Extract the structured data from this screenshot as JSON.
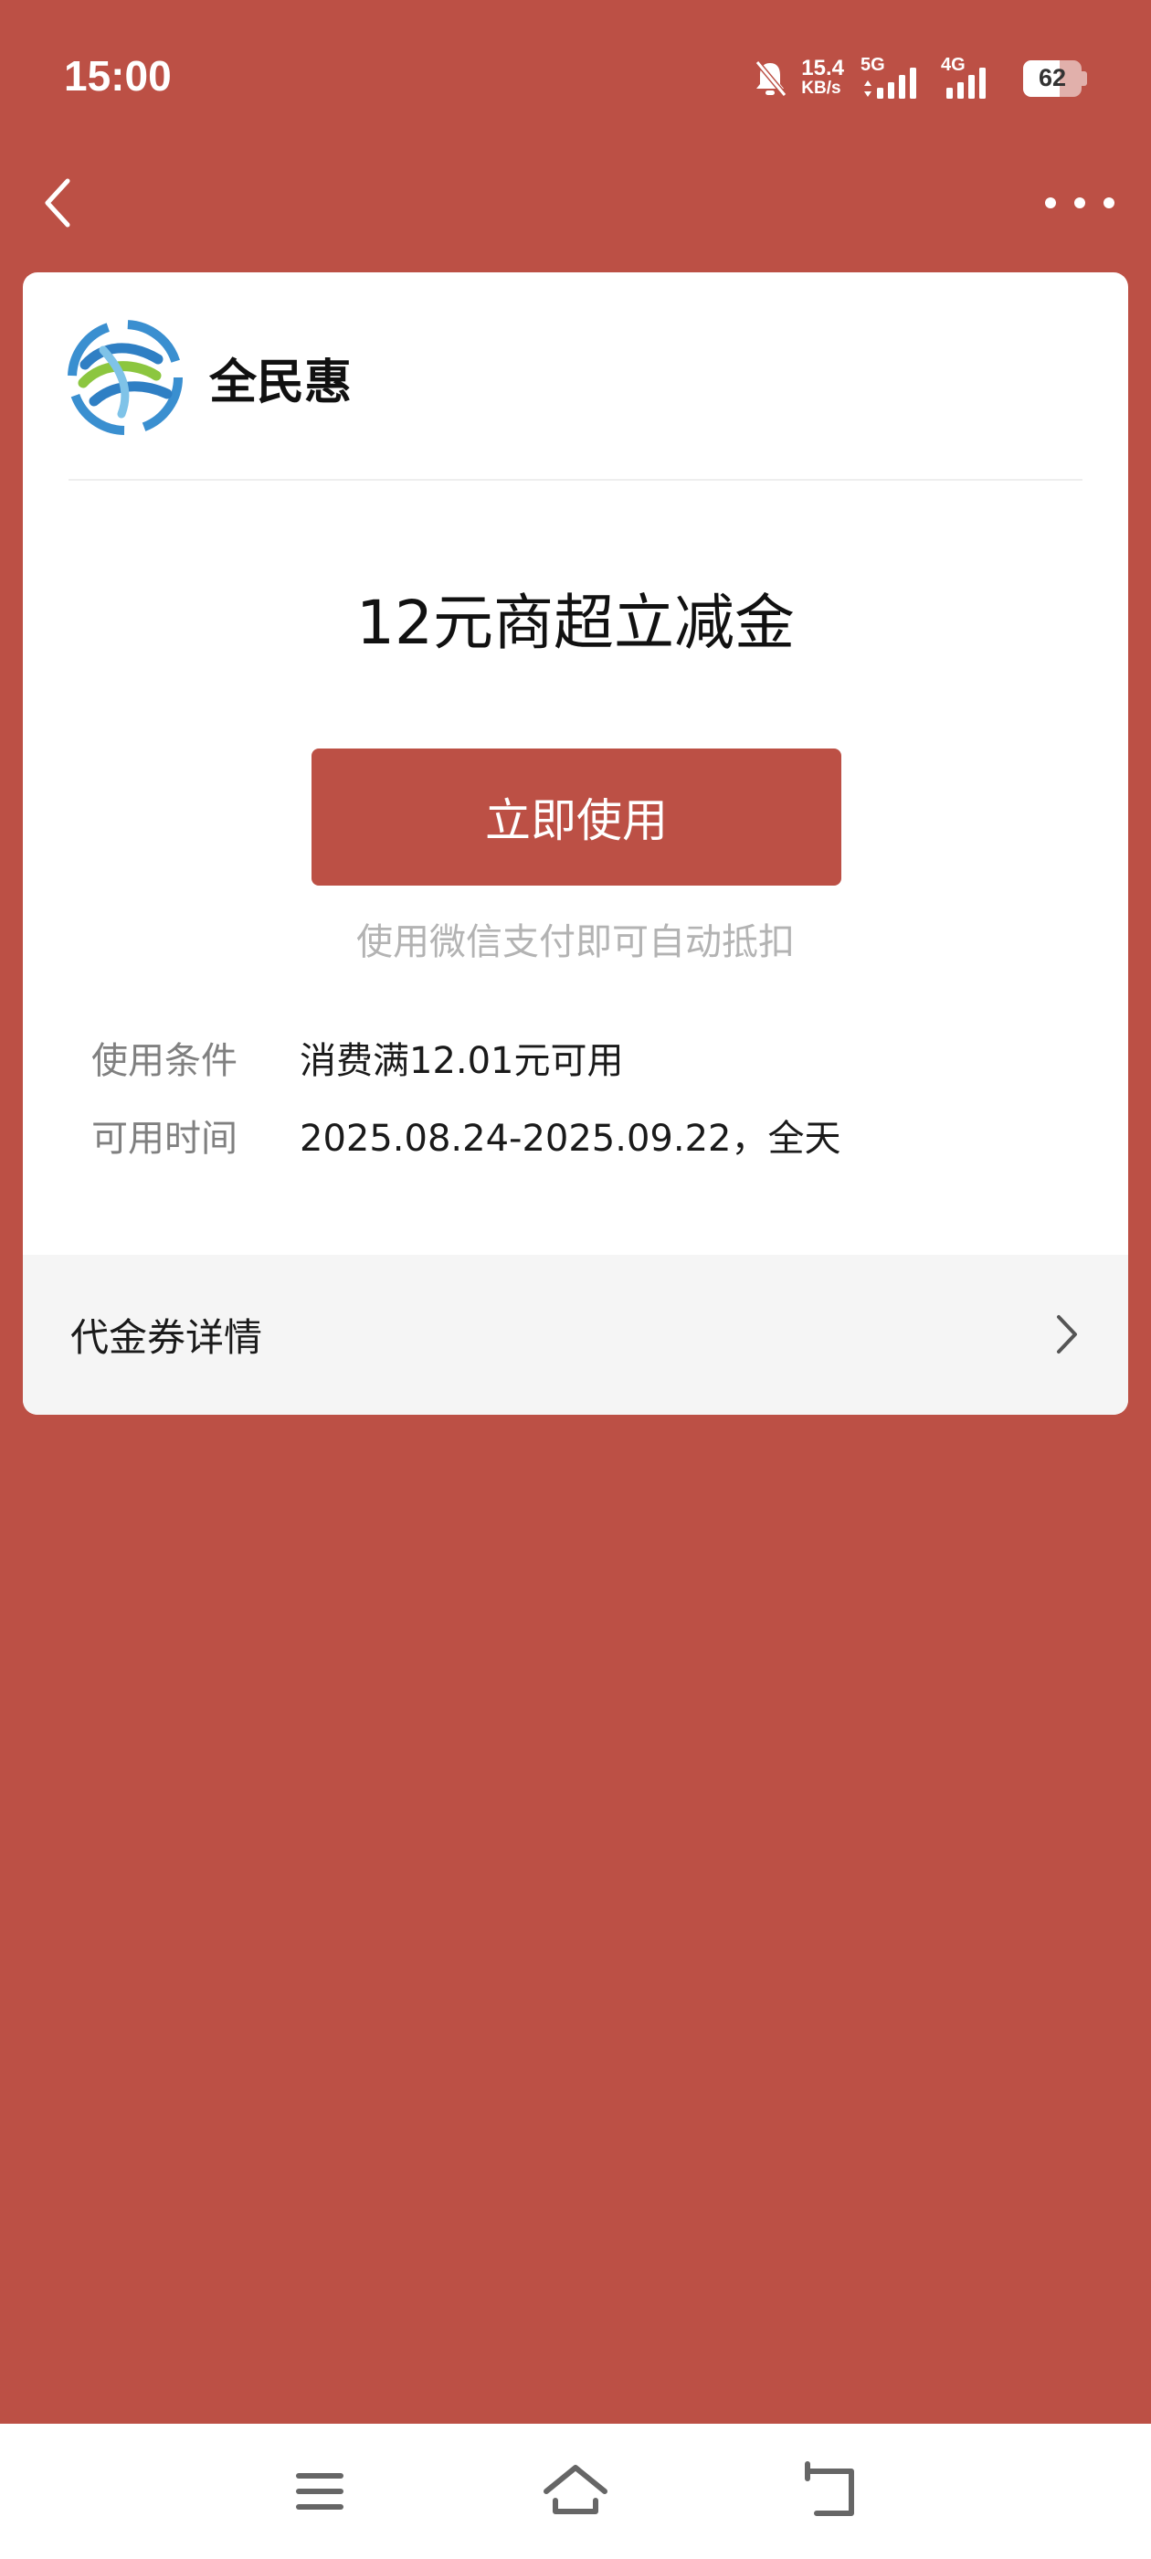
{
  "status_bar": {
    "time": "15:00",
    "net_speed_value": "15.4",
    "net_speed_unit": "KB/s",
    "signal1_label": "5G",
    "signal2_label": "4G",
    "battery_level": "62",
    "icons": [
      "bell-muted-icon",
      "signal-icon",
      "signal-icon",
      "battery-icon"
    ]
  },
  "nav": {
    "back_icon": "chevron-left-icon",
    "more_icon": "more-dots-icon"
  },
  "card": {
    "brand_logo": "china-mobile-logo",
    "brand_name": "全民惠",
    "coupon_title": "12元商超立减金",
    "use_button": "立即使用",
    "use_hint": "使用微信支付即可自动抵扣",
    "conditions_label": "使用条件",
    "conditions_value": "消费满12.01元可用",
    "time_label": "可用时间",
    "time_value": "2025.08.24-2025.09.22，全天",
    "details_label": "代金券详情"
  },
  "bottom_nav": {
    "icons": [
      "menu-icon",
      "home-icon",
      "back-icon"
    ]
  },
  "colors": {
    "background": "#BC5045",
    "button": "#BC5045",
    "card": "#FFFFFF"
  }
}
